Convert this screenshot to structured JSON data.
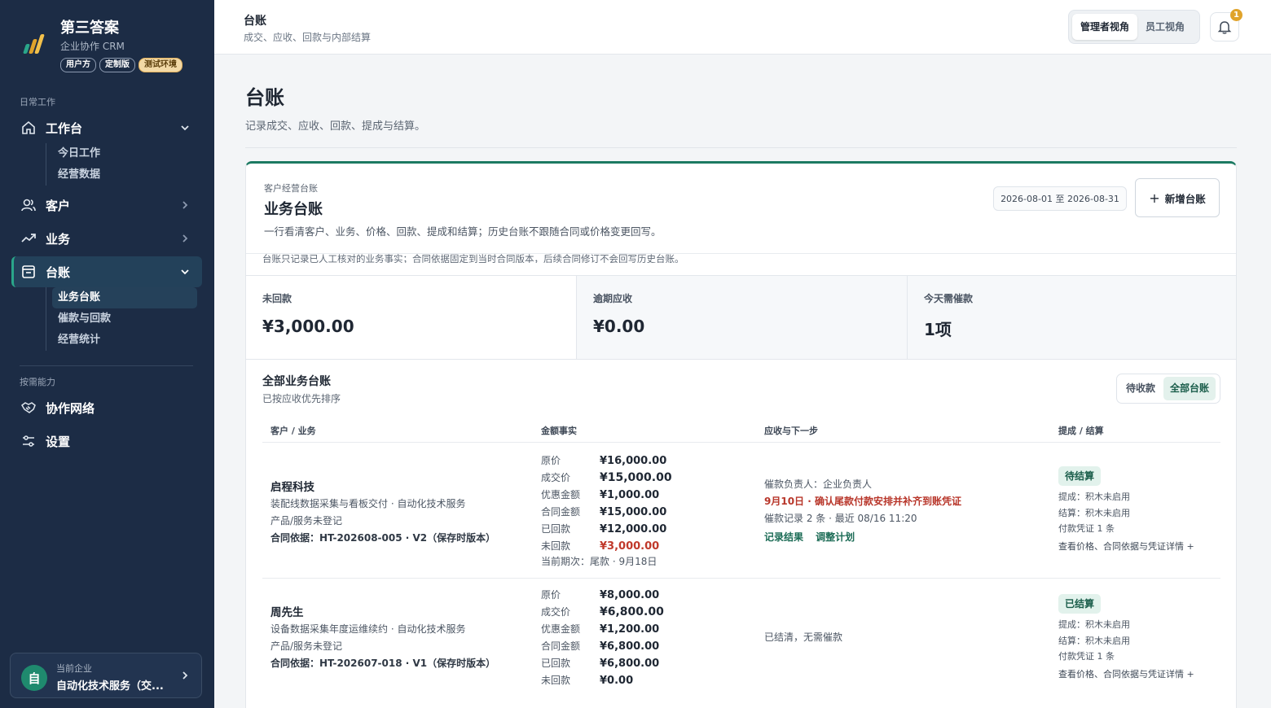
{
  "brand": {
    "title": "第三答案",
    "subtitle": "企业协作 CRM",
    "tags": [
      "用户方",
      "定制版",
      "测试环境"
    ]
  },
  "nav": {
    "section_daily": "日常工作",
    "workbench": {
      "label": "工作台",
      "children": [
        "今日工作",
        "经营数据"
      ]
    },
    "customers": {
      "label": "客户"
    },
    "business": {
      "label": "业务"
    },
    "ledger": {
      "label": "台账",
      "children": [
        "业务台账",
        "催款与回款",
        "经营统计"
      ]
    },
    "section_ondemand": "按需能力",
    "network": {
      "label": "协作网络"
    },
    "settings": {
      "label": "设置"
    }
  },
  "company": {
    "label": "当前企业",
    "avatar": "自",
    "name": "自动化技术服务（交..."
  },
  "topbar": {
    "title": "台账",
    "subtitle": "成交、应收、回款与内部结算",
    "view_manager": "管理者视角",
    "view_staff": "员工视角",
    "notification_count": "1"
  },
  "page": {
    "title": "台账",
    "description": "记录成交、应收、回款、提成与结算。"
  },
  "card": {
    "kicker": "客户经营台账",
    "title": "业务台账",
    "description": "一行看清客户、业务、价格、回款、提成和结算；历史台账不跟随合同或价格变更回写。",
    "date_range": "2026-08-01 至 2026-08-31",
    "add_label": "新增台账",
    "note": "台账只记录已人工核对的业务事实；合同依据固定到当时合同版本，后续合同修订不会回写历史台账。"
  },
  "stats": [
    {
      "label": "未回款",
      "value": "¥3,000.00"
    },
    {
      "label": "逾期应收",
      "value": "¥0.00"
    },
    {
      "label": "今天需催款",
      "value": "1项"
    }
  ],
  "list": {
    "title": "全部业务台账",
    "subtitle": "已按应收优先排序",
    "filter_pending": "待收款",
    "filter_all": "全部台账",
    "columns": {
      "customer": "客户 / 业务",
      "amount": "金额事实",
      "next": "应收与下一步",
      "settle": "提成 / 结算"
    }
  },
  "rows": [
    {
      "customer": "启程科技",
      "service": "装配线数据采集与看板交付 · 自动化技术服务",
      "product": "产品/服务未登记",
      "basis": "合同依据：HT-202608-005 · V2（保存时版本）",
      "amounts": [
        {
          "k": "原价",
          "v": "¥16,000.00"
        },
        {
          "k": "成交价",
          "v": "¥15,000.00"
        },
        {
          "k": "优惠金额",
          "v": "¥1,000.00"
        },
        {
          "k": "合同金额",
          "v": "¥15,000.00"
        },
        {
          "k": "已回款",
          "v": "¥12,000.00"
        },
        {
          "k": "未回款",
          "v": "¥3,000.00"
        }
      ],
      "period": "当前期次：尾款 · 9月18日",
      "owner": "催款负责人：企业负责人",
      "alert": "9月10日 · 确认尾款付款安排并补齐到账凭证",
      "records": "催款记录 2 条 · 最近 08/16 11:20",
      "link_record": "记录结果",
      "link_adjust": "调整计划",
      "status": "待结算",
      "commission": "提成：积木未启用",
      "settlement": "结算：积木未启用",
      "voucher": "付款凭证 1 条",
      "detail": "查看价格、合同依据与凭证详情 +"
    },
    {
      "customer": "周先生",
      "service": "设备数据采集年度运维续约 · 自动化技术服务",
      "product": "产品/服务未登记",
      "basis": "合同依据：HT-202607-018 · V1（保存时版本）",
      "amounts": [
        {
          "k": "原价",
          "v": "¥8,000.00"
        },
        {
          "k": "成交价",
          "v": "¥6,800.00"
        },
        {
          "k": "优惠金额",
          "v": "¥1,200.00"
        },
        {
          "k": "合同金额",
          "v": "¥6,800.00"
        },
        {
          "k": "已回款",
          "v": "¥6,800.00"
        },
        {
          "k": "未回款",
          "v": "¥0.00"
        }
      ],
      "next_text": "已结清，无需催款",
      "status": "已结算",
      "commission": "提成：积木未启用",
      "settlement": "结算：积木未启用",
      "voucher": "付款凭证 1 条",
      "detail": "查看价格、合同依据与凭证详情 +"
    }
  ],
  "colors": {
    "sidebar": "#1c2c45",
    "accent": "#1c7a62",
    "danger": "#c0392b",
    "badge": "#e0a32b"
  },
  "icons": [
    "home-icon",
    "user-icon",
    "trend-icon",
    "ledger-icon",
    "handshake-icon",
    "sliders-icon",
    "bell-icon",
    "chevron-icon",
    "plus-icon"
  ]
}
